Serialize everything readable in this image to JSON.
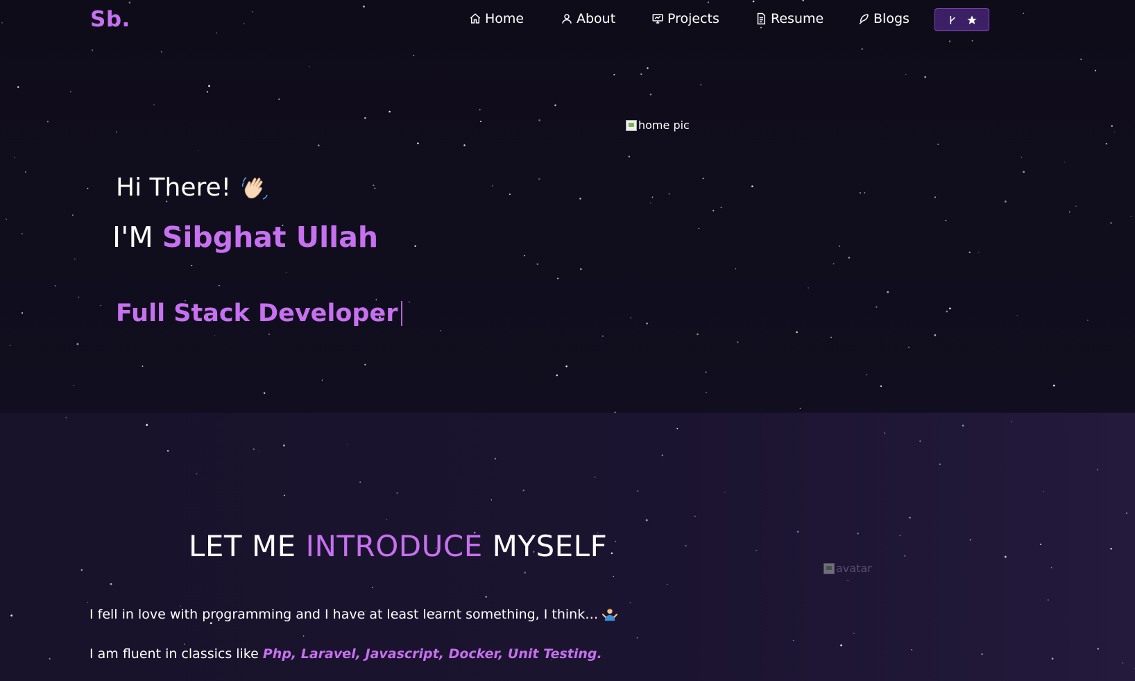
{
  "navbar": {
    "brand": "Sb.",
    "items": [
      {
        "label": "Home",
        "icon": "home-icon"
      },
      {
        "label": "About",
        "icon": "user-icon"
      },
      {
        "label": "Projects",
        "icon": "presentation-icon"
      },
      {
        "label": "Resume",
        "icon": "document-icon"
      },
      {
        "label": "Blogs",
        "icon": "feather-icon"
      }
    ],
    "github_button": {
      "icons": [
        "git-fork-icon",
        "star-icon"
      ]
    }
  },
  "hero": {
    "greeting": "Hi There!",
    "greeting_emoji": "waving-hand-icon",
    "im_prefix": "I'M",
    "name": "Sibghat Ullah",
    "typed_text": "Full Stack Developer",
    "image_alt": "home pic"
  },
  "intro": {
    "title_part1": "LET ME",
    "title_accent": "INTRODUCE",
    "title_part2": "MYSELF",
    "paragraph1": "I fell in love with programming and I have at least learnt something, I think…",
    "paragraph1_emoji": "shrugging-person-icon",
    "paragraph2_prefix": "I am fluent in classics like",
    "paragraph2_tech": "Php, Laravel, Javascript, Docker, Unit Testing.",
    "avatar_alt": "avatar"
  },
  "colors": {
    "accent": "#c770f0",
    "background": "#0f0c1a",
    "intro_background": "#1b1430",
    "github_button_bg": "#3b2065"
  }
}
